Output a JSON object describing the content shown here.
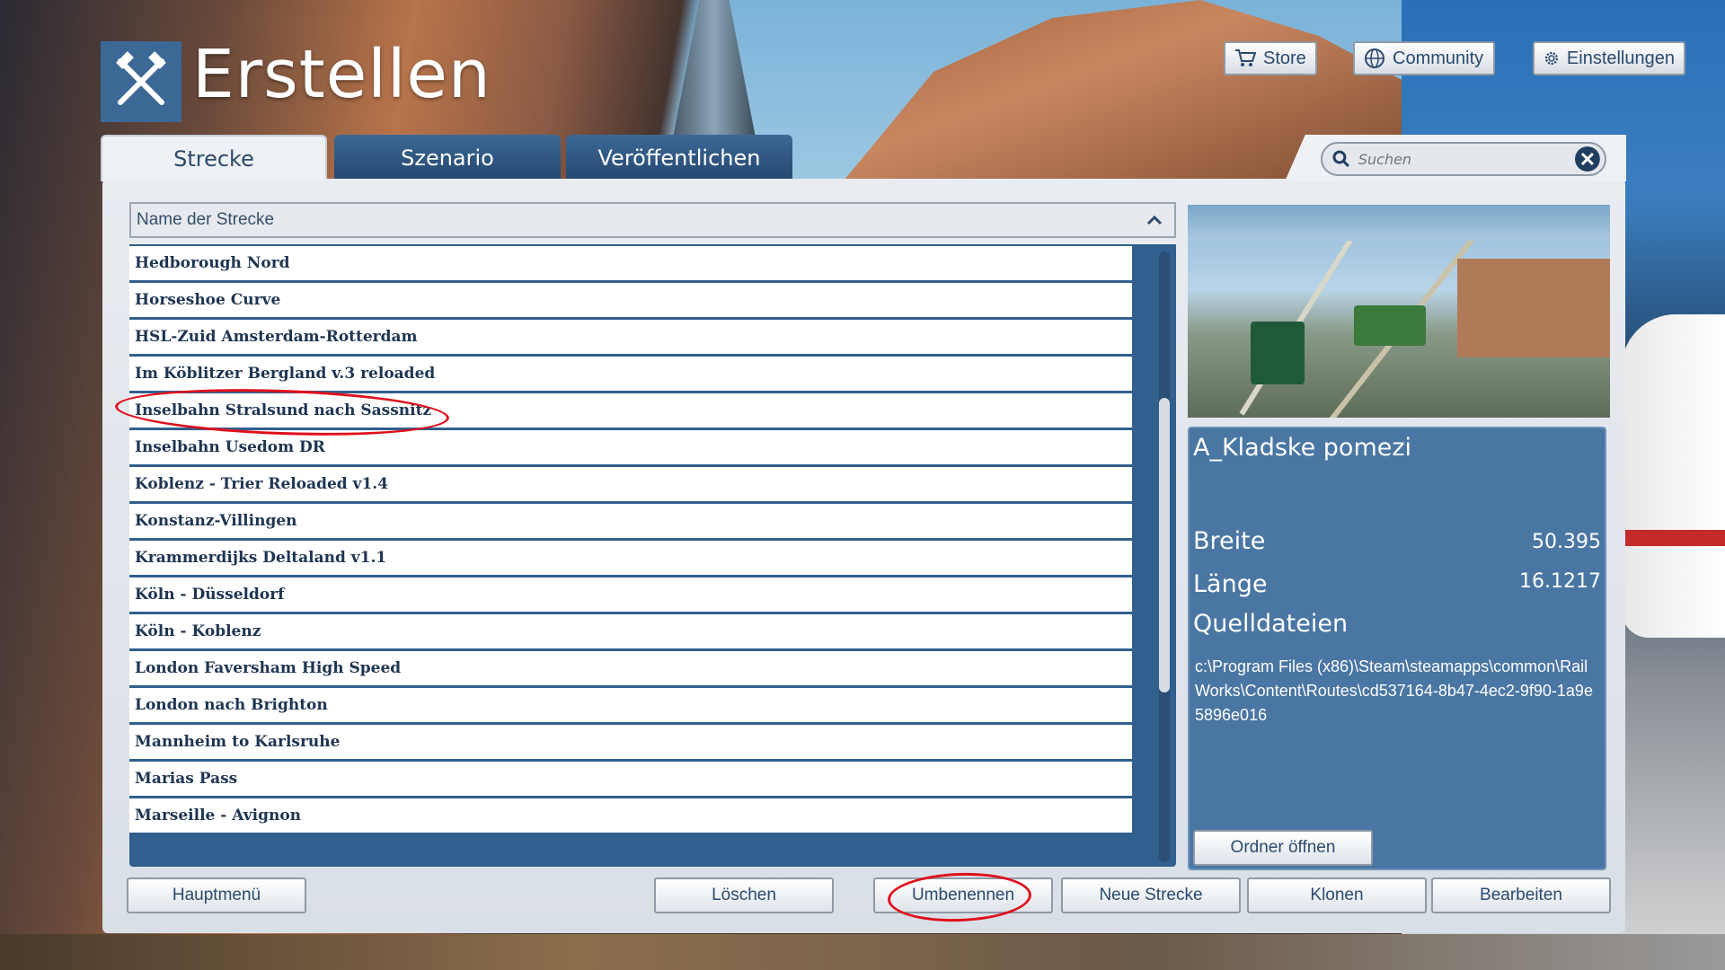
{
  "header": {
    "title": "Erstellen"
  },
  "top_buttons": {
    "store": "Store",
    "community": "Community",
    "settings": "Einstellungen"
  },
  "tabs": [
    {
      "label": "Strecke",
      "active": true
    },
    {
      "label": "Szenario",
      "active": false
    },
    {
      "label": "Veröffentlichen",
      "active": false
    }
  ],
  "search": {
    "placeholder": "Suchen"
  },
  "list": {
    "header": "Name der Strecke",
    "items": [
      "Hedborough Nord",
      "Horseshoe Curve",
      "HSL-Zuid Amsterdam-Rotterdam",
      "Im Köblitzer Bergland v.3 reloaded",
      "Inselbahn Stralsund nach Sassnitz",
      "Inselbahn Usedom DR",
      "Koblenz - Trier Reloaded v1.4",
      "Konstanz-Villingen",
      "Krammerdijks Deltaland v1.1",
      "Köln - Düsseldorf",
      "Köln - Koblenz",
      "London Faversham High Speed",
      "London nach Brighton",
      "Mannheim to Karlsruhe",
      "Marias Pass",
      "Marseille - Avignon"
    ]
  },
  "info": {
    "name": "A_Kladske pomezi",
    "width_label": "Breite",
    "width_value": "50.395",
    "length_label": "Länge",
    "length_value": "16.1217",
    "source_label": "Quelldateien",
    "source_path": "c:\\Program Files (x86)\\Steam\\steamapps\\common\\RailWorks\\Content\\Routes\\cd537164-8b47-4ec2-9f90-1a9e5896e016",
    "open_folder": "Ordner öffnen"
  },
  "bottom_buttons": {
    "main_menu": "Hauptmenü",
    "delete": "Löschen",
    "rename": "Umbenennen",
    "new_route": "Neue Strecke",
    "clone": "Klonen",
    "edit": "Bearbeiten"
  },
  "colors": {
    "accent": "#3c6896",
    "annotation": "#e0101c"
  }
}
